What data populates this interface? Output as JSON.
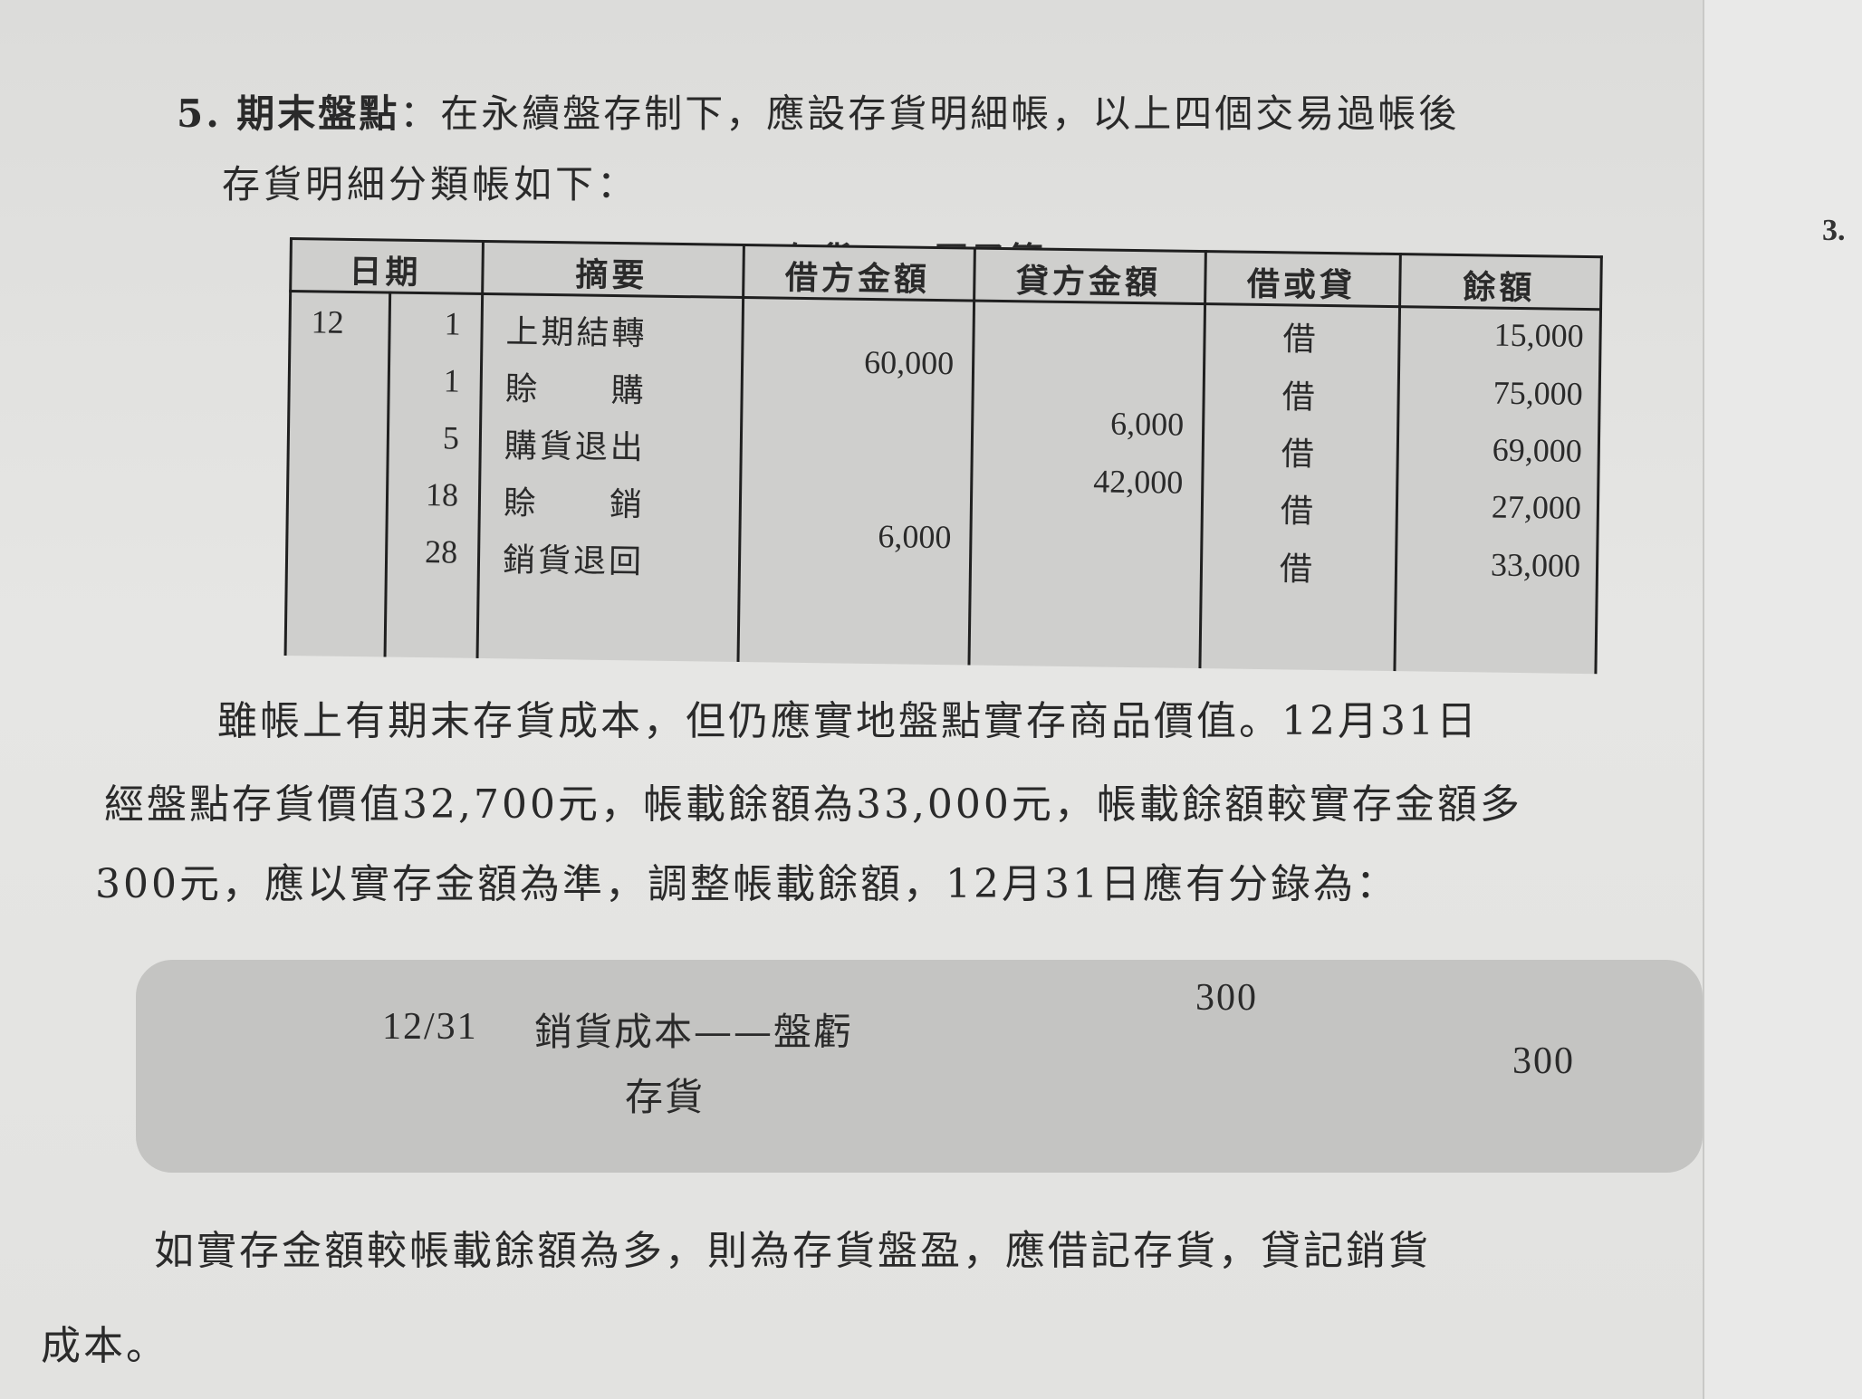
{
  "heading": {
    "number": "5.",
    "title": "期末盤點",
    "text": "：在永續盤存制下，應設存貨明細帳，以上四個交易過帳後",
    "line2": "存貨明細分類帳如下："
  },
  "side_number": "3.",
  "ledger": {
    "title": "存貨——原子筆",
    "headers": {
      "date": "日期",
      "summary": "摘要",
      "debit": "借方金額",
      "credit": "貸方金額",
      "dr_cr": "借或貸",
      "balance": "餘額"
    },
    "rows": [
      {
        "month": "12",
        "day": "1",
        "summary": "上期結轉",
        "debit": "",
        "credit": "",
        "dr_cr": "借",
        "balance": "15,000"
      },
      {
        "month": "",
        "day": "1",
        "summary": "賒　　購",
        "debit": "60,000",
        "credit": "",
        "dr_cr": "借",
        "balance": "75,000"
      },
      {
        "month": "",
        "day": "5",
        "summary": "購貨退出",
        "debit": "",
        "credit": "6,000",
        "dr_cr": "借",
        "balance": "69,000"
      },
      {
        "month": "",
        "day": "18",
        "summary": "賒　　銷",
        "debit": "",
        "credit": "42,000",
        "dr_cr": "借",
        "balance": "27,000"
      },
      {
        "month": "",
        "day": "28",
        "summary": "銷貨退回",
        "debit": "6,000",
        "credit": "",
        "dr_cr": "借",
        "balance": "33,000"
      }
    ]
  },
  "paragraph1": {
    "line1": "雖帳上有期末存貨成本，但仍應實地盤點實存商品價值。12月31日",
    "line2": "經盤點存貨價值32,700元，帳載餘額為33,000元，帳載餘額較實存金額多",
    "line3": "300元，應以實存金額為準，調整帳載餘額，12月31日應有分錄為："
  },
  "journal": {
    "date": "12/31",
    "debit_account": "銷貨成本——盤虧",
    "debit_amount": "300",
    "credit_account": "存貨",
    "credit_amount": "300"
  },
  "paragraph2": {
    "line1": "如實存金額較帳載餘額為多，則為存貨盤盈，應借記存貨，貸記銷貨",
    "line2": "成本。"
  }
}
